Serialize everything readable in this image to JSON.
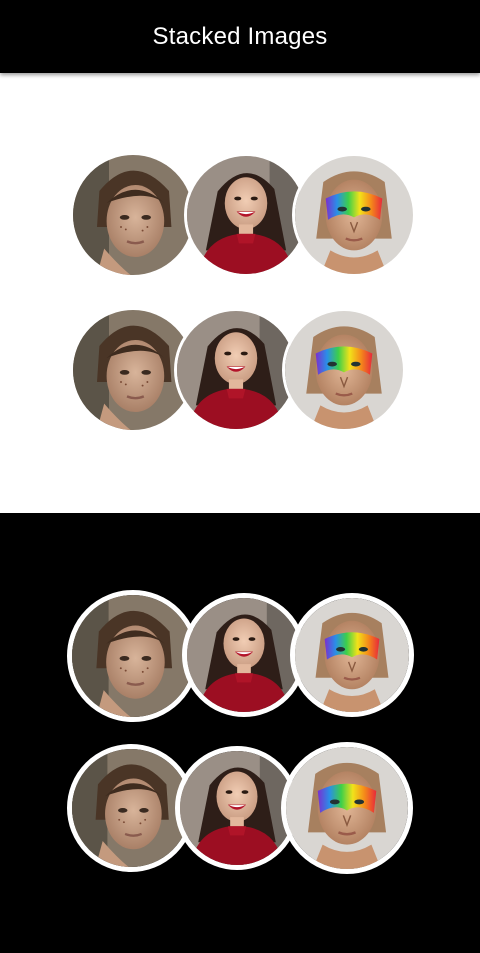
{
  "app_bar": {
    "title": "Stacked Images"
  },
  "avatars": [
    {
      "person": "freckled-woman"
    },
    {
      "person": "smiling-woman-red-top"
    },
    {
      "person": "rainbow-makeup-woman"
    }
  ],
  "colors": {
    "app_bar_background": "#000000",
    "title_text": "#ffffff",
    "light_section_background": "#ffffff",
    "dark_section_background": "#000000",
    "avatar_ring": "#ffffff"
  }
}
